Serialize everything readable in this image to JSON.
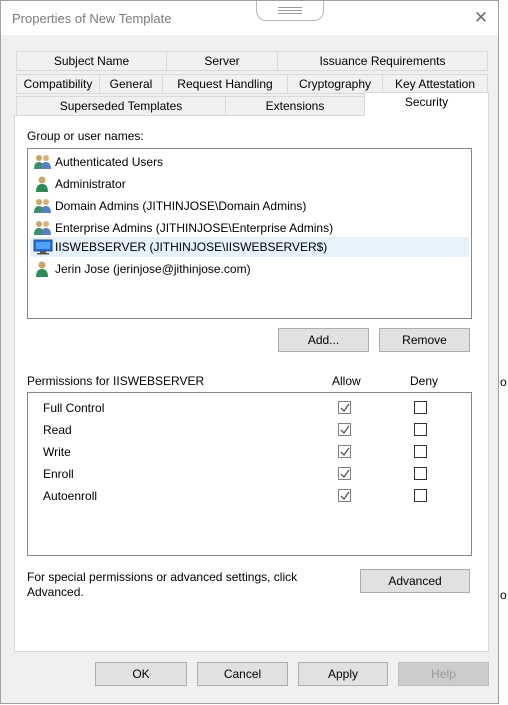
{
  "window": {
    "title": "Properties of New Template",
    "close_glyph": "✕"
  },
  "tabs": {
    "row1": [
      "Subject Name",
      "Server",
      "Issuance Requirements"
    ],
    "row2": [
      "Compatibility",
      "General",
      "Request Handling",
      "Cryptography",
      "Key Attestation"
    ],
    "row3": [
      "Superseded Templates",
      "Extensions",
      "Security"
    ],
    "active": "Security"
  },
  "security": {
    "group_label": "Group or user names:",
    "users": [
      {
        "name": "Authenticated Users",
        "icon": "group-icon"
      },
      {
        "name": "Administrator",
        "icon": "user-icon"
      },
      {
        "name": "Domain Admins (JITHINJOSE\\Domain Admins)",
        "icon": "group-icon"
      },
      {
        "name": "Enterprise Admins (JITHINJOSE\\Enterprise Admins)",
        "icon": "group-icon"
      },
      {
        "name": "IISWEBSERVER (JITHINJOSE\\IISWEBSERVER$)",
        "icon": "computer-icon",
        "selected": true
      },
      {
        "name": "Jerin Jose (jerinjose@jithinjose.com)",
        "icon": "user-icon"
      }
    ],
    "add_label": "Add...",
    "remove_label": "Remove",
    "permissions_label": "Permissions for IISWEBSERVER",
    "allow_label": "Allow",
    "deny_label": "Deny",
    "permissions": [
      {
        "name": "Full Control",
        "allow": true,
        "deny": false
      },
      {
        "name": "Read",
        "allow": true,
        "deny": false
      },
      {
        "name": "Write",
        "allow": true,
        "deny": false
      },
      {
        "name": "Enroll",
        "allow": true,
        "deny": false
      },
      {
        "name": "Autoenroll",
        "allow": true,
        "deny": false
      }
    ],
    "special_text_1": "For special permissions or advanced settings, click",
    "special_text_2": "Advanced.",
    "advanced_label": "Advanced"
  },
  "footer": {
    "ok": "OK",
    "cancel": "Cancel",
    "apply": "Apply",
    "help": "Help"
  },
  "background_glyphs": [
    "o",
    "o"
  ],
  "colors": {
    "selection": "#e5f1fb",
    "window_bg": "#f0f0f0",
    "button_bg": "#e1e1e1"
  }
}
